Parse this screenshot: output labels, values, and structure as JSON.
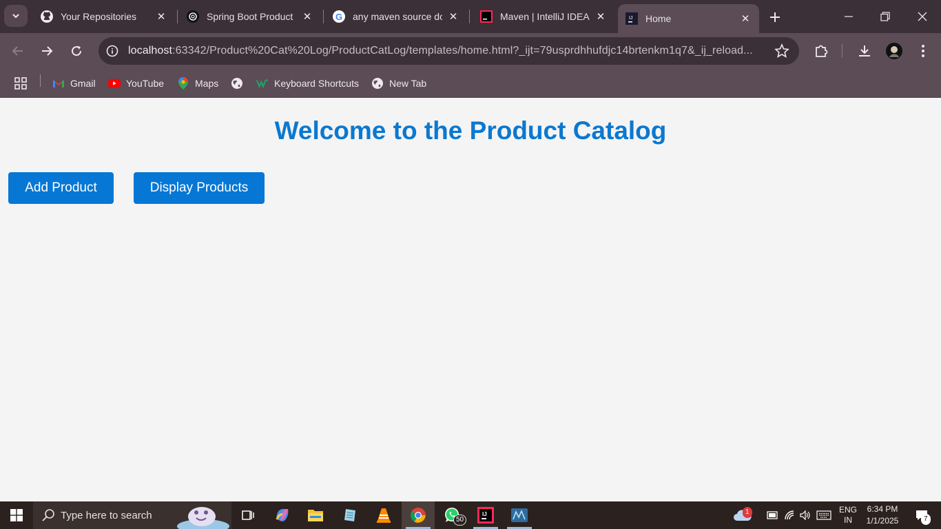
{
  "browser": {
    "tabs": [
      {
        "title": "Your Repositories",
        "icon": "github-icon"
      },
      {
        "title": "Spring Boot Product",
        "icon": "chatgpt-icon"
      },
      {
        "title": "any maven source do",
        "icon": "google-icon"
      },
      {
        "title": "Maven | IntelliJ IDEA",
        "icon": "intellij-icon"
      },
      {
        "title": "Home",
        "icon": "intellij-icon",
        "active": true
      }
    ],
    "url_host": "localhost",
    "url_rest": ":63342/Product%20Cat%20Log/ProductCatLog/templates/home.html?_ijt=79usprdhhufdjc14brtenkm1q7&_ij_reload...",
    "bookmarks": [
      {
        "label": "Gmail",
        "icon": "gmail-icon"
      },
      {
        "label": "YouTube",
        "icon": "youtube-icon"
      },
      {
        "label": "Maps",
        "icon": "maps-icon"
      },
      {
        "label": "",
        "icon": "globe-icon"
      },
      {
        "label": "Keyboard Shortcuts",
        "icon": "shortcuts-icon"
      },
      {
        "label": "New Tab",
        "icon": "globe-icon"
      }
    ]
  },
  "page": {
    "heading": "Welcome to the Product Catalog",
    "add_button": "Add Product",
    "display_button": "Display Products"
  },
  "taskbar": {
    "search_placeholder": "Type here to search",
    "whatsapp_badge": "50",
    "weather_badge": "1",
    "language_top": "ENG",
    "language_bottom": "IN",
    "time": "6:34 PM",
    "date": "1/1/2025",
    "notification_count": "7"
  },
  "colors": {
    "heading": "#0b78d0",
    "button": "#0677d4",
    "page_bg": "#f4f4f4",
    "chrome_dark": "#3b2f38",
    "chrome_light": "#5b4c56"
  }
}
